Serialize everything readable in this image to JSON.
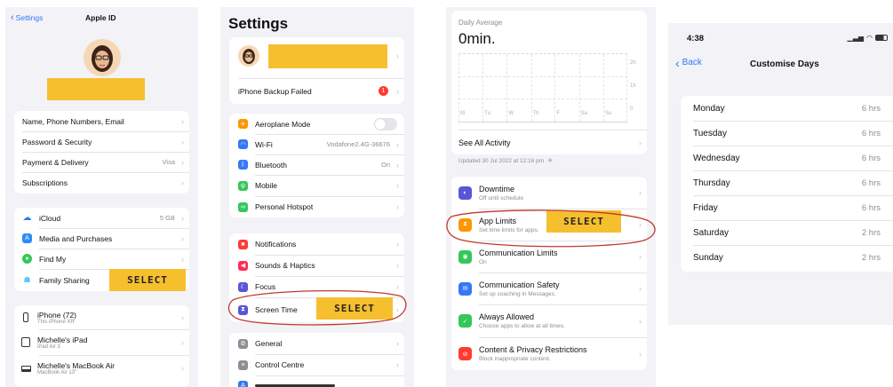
{
  "panel1": {
    "back_label": "Settings",
    "title": "Apple ID",
    "group1": [
      {
        "label": "Name, Phone Numbers, Email",
        "value": ""
      },
      {
        "label": "Password & Security",
        "value": ""
      },
      {
        "label": "Payment & Delivery",
        "value": "Visa"
      },
      {
        "label": "Subscriptions",
        "value": ""
      }
    ],
    "group2": [
      {
        "label": "iCloud",
        "value": "5 GB",
        "icon": "cloud-icon",
        "color": "#3478f6"
      },
      {
        "label": "Media and Purchases",
        "value": "",
        "icon": "app-store-icon",
        "color": "#2b8cf7"
      },
      {
        "label": "Find My",
        "value": "",
        "icon": "find-my-icon",
        "color": "#34c759"
      },
      {
        "label": "Family Sharing",
        "value": "",
        "icon": "family-icon",
        "color": "#5ac8fa"
      }
    ],
    "select_label": "SELECT",
    "devices": [
      {
        "name": "iPhone (72)",
        "sub": "This iPhone XR"
      },
      {
        "name": "Michelle's iPad",
        "sub": "iPad Air 3"
      },
      {
        "name": "Michelle's MacBook Air",
        "sub": "MacBook Air 13\""
      }
    ]
  },
  "panel2": {
    "title": "Settings",
    "backup_label": "iPhone Backup Failed",
    "backup_badge": "1",
    "group1": [
      {
        "label": "Aeroplane Mode",
        "value": "",
        "icon": "airplane-icon",
        "color": "#ff9500"
      },
      {
        "label": "Wi-Fi",
        "value": "Vodafone2.4G-36676",
        "icon": "wifi-icon",
        "color": "#3478f6"
      },
      {
        "label": "Bluetooth",
        "value": "On",
        "icon": "bluetooth-icon",
        "color": "#3478f6"
      },
      {
        "label": "Mobile",
        "value": "",
        "icon": "antenna-icon",
        "color": "#34c759"
      },
      {
        "label": "Personal Hotspot",
        "value": "",
        "icon": "hotspot-icon",
        "color": "#34c759"
      }
    ],
    "group2": [
      {
        "label": "Notifications",
        "value": "",
        "icon": "bell-icon",
        "color": "#ff3b30"
      },
      {
        "label": "Sounds & Haptics",
        "value": "",
        "icon": "speaker-icon",
        "color": "#ff2d55"
      },
      {
        "label": "Focus",
        "value": "",
        "icon": "moon-icon",
        "color": "#5856d6"
      },
      {
        "label": "Screen Time",
        "value": "",
        "icon": "hourglass-icon",
        "color": "#5856d6"
      }
    ],
    "group3": [
      {
        "label": "General",
        "value": "",
        "icon": "gear-icon",
        "color": "#8e8e93"
      },
      {
        "label": "Control Centre",
        "value": "",
        "icon": "switches-icon",
        "color": "#8e8e93"
      }
    ],
    "select_label": "SELECT"
  },
  "panel3": {
    "daily_avg_label": "Daily Average",
    "daily_avg_value": "0min.",
    "chart_right_labels": [
      "2h",
      "1h",
      "0"
    ],
    "chart_days": [
      "M",
      "Tu",
      "W",
      "Th",
      "F",
      "Sa",
      "Su"
    ],
    "see_all": "See All Activity",
    "updated": "Updated 30 Jul 2022 at 12:16 pm",
    "items": [
      {
        "title": "Downtime",
        "sub": "Off until schedule",
        "icon": "downtime-icon",
        "color": "#5856d6"
      },
      {
        "title": "App Limits",
        "sub": "Set time limits for apps.",
        "icon": "hourglass-icon",
        "color": "#ff9500"
      },
      {
        "title": "Communication Limits",
        "sub": "On",
        "icon": "person-circle-icon",
        "color": "#34c759"
      },
      {
        "title": "Communication Safety",
        "sub": "Set up coaching in Messages.",
        "icon": "chat-bubble-icon",
        "color": "#3478f6"
      },
      {
        "title": "Always Allowed",
        "sub": "Choose apps to allow at all times.",
        "icon": "checkmark-icon",
        "color": "#34c759"
      },
      {
        "title": "Content & Privacy Restrictions",
        "sub": "Block inappropriate content.",
        "icon": "no-entry-icon",
        "color": "#ff3b30"
      }
    ],
    "select_label": "SELECT"
  },
  "panel4": {
    "time": "4:38",
    "back_label": "Back",
    "title": "Customise Days",
    "days": [
      {
        "label": "Monday",
        "value": "6 hrs"
      },
      {
        "label": "Tuesday",
        "value": "6 hrs"
      },
      {
        "label": "Wednesday",
        "value": "6 hrs"
      },
      {
        "label": "Thursday",
        "value": "6 hrs"
      },
      {
        "label": "Friday",
        "value": "6 hrs"
      },
      {
        "label": "Saturday",
        "value": "2 hrs"
      },
      {
        "label": "Sunday",
        "value": "2 hrs"
      }
    ]
  }
}
